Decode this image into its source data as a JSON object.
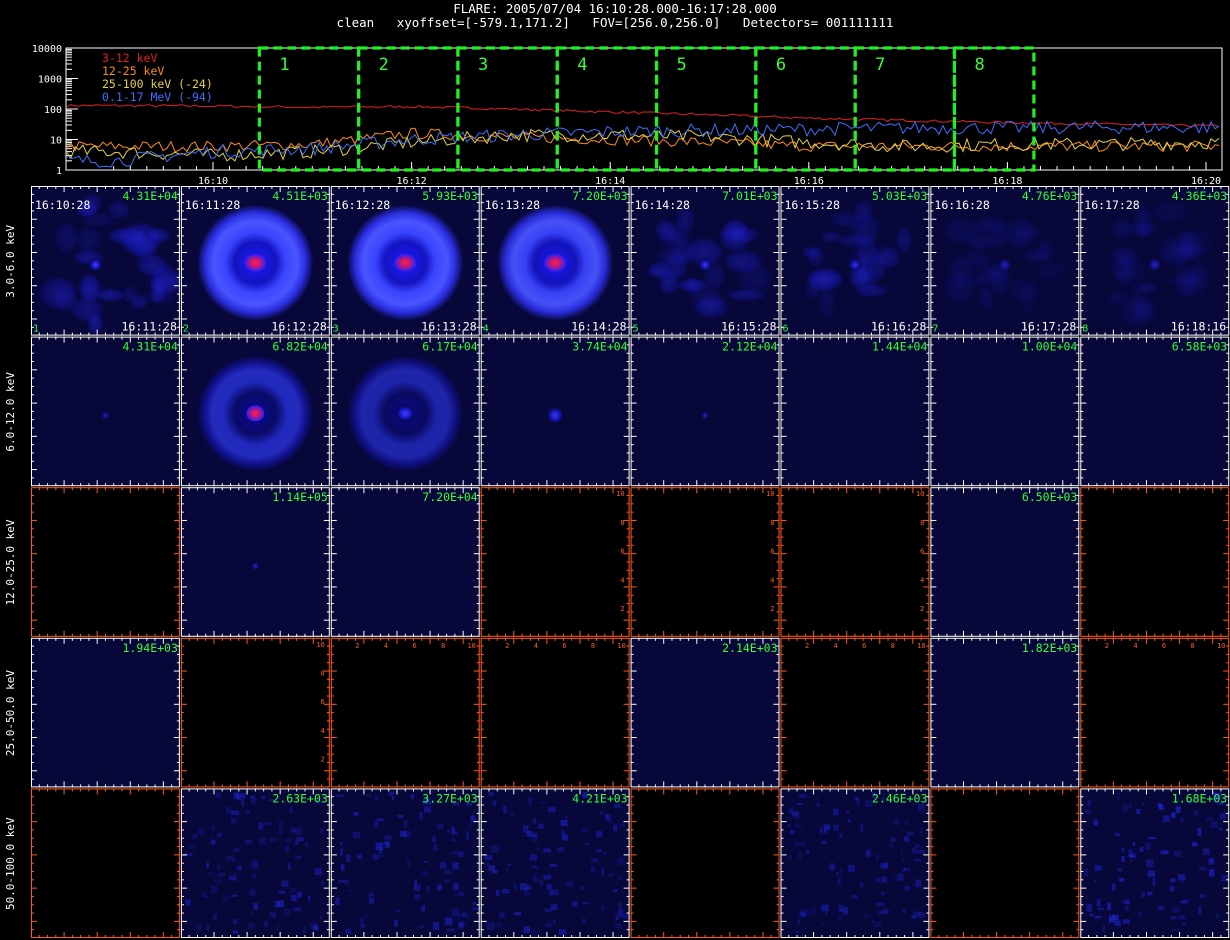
{
  "header": {
    "line1": "FLARE: 2005/07/04 16:10:28.000-16:17:28.000",
    "line2": "clean   xyoffset=[-579.1,171.2]   FOV=[256.0,256.0]   Detectors= 001111111"
  },
  "colors": {
    "low": "#e02020",
    "mid": "#ff8c1a",
    "high": "#e6d040",
    "gamma": "#3a70ff",
    "box": "#22ee22",
    "label": "#33ff33",
    "frame": "#ffffff",
    "frame_empty": "#ff5a1e",
    "image_bg": "#07073a"
  },
  "chart_data": [
    {
      "type": "line",
      "y_scale": "log",
      "ylim": [
        1,
        10000
      ],
      "y_ticks": [
        "10000",
        "1000",
        "100",
        "10",
        "1"
      ],
      "x_range_minutes": [
        16.05,
        16.35
      ],
      "x_ticks": [
        "16:10",
        "16:12",
        "16:14",
        "16:16",
        "16:18",
        "16:20"
      ],
      "series": [
        {
          "name": "3-12 keV",
          "color": "#e02020",
          "x": [
            "16:09",
            "16:10",
            "16:11",
            "16:12",
            "16:13",
            "16:14",
            "16:15",
            "16:16",
            "16:17",
            "16:18",
            "16:19",
            "16:20"
          ],
          "values": [
            130,
            125,
            115,
            120,
            100,
            80,
            65,
            50,
            42,
            36,
            32,
            28
          ]
        },
        {
          "name": "12-25 keV",
          "color": "#ff8c1a",
          "x": [
            "16:09",
            "16:10",
            "16:11",
            "16:12",
            "16:13",
            "16:14",
            "16:15",
            "16:16",
            "16:17",
            "16:18",
            "16:19",
            "16:20"
          ],
          "values": [
            6,
            6,
            7,
            16,
            12,
            10,
            8,
            6,
            6,
            6,
            6,
            6
          ]
        },
        {
          "name": "25-100 keV (-24)",
          "color": "#e6d040",
          "x": [
            "16:09",
            "16:10",
            "16:11",
            "16:12",
            "16:13",
            "16:14",
            "16:15",
            "16:16",
            "16:17",
            "16:18",
            "16:19",
            "16:20"
          ],
          "values": [
            4,
            3,
            4,
            8,
            14,
            14,
            12,
            8,
            6,
            7,
            7,
            8
          ]
        },
        {
          "name": "0.1-17 MeV (-94)",
          "color": "#3a70ff",
          "x": [
            "16:09",
            "16:10",
            "16:11",
            "16:12",
            "16:13",
            "16:14",
            "16:15",
            "16:16",
            "16:17",
            "16:18",
            "16:19",
            "16:20"
          ],
          "values": [
            2,
            4,
            5,
            10,
            14,
            18,
            20,
            22,
            24,
            24,
            25,
            25
          ]
        }
      ],
      "intervals": [
        {
          "label": "1",
          "start": "16:10:28",
          "end": "16:11:28"
        },
        {
          "label": "2",
          "start": "16:11:28",
          "end": "16:12:28"
        },
        {
          "label": "3",
          "start": "16:12:28",
          "end": "16:13:28"
        },
        {
          "label": "4",
          "start": "16:13:28",
          "end": "16:14:28"
        },
        {
          "label": "5",
          "start": "16:14:28",
          "end": "16:15:28"
        },
        {
          "label": "6",
          "start": "16:15:28",
          "end": "16:16:28"
        },
        {
          "label": "7",
          "start": "16:16:28",
          "end": "16:17:28"
        },
        {
          "label": "8",
          "start": "16:17:28",
          "end": "16:18:16"
        }
      ]
    },
    {
      "type": "heatmap",
      "row_labels": [
        "3.0-6.0 keV",
        "6.0-12.0 keV",
        "12.0-25.0 keV",
        "25.0-50.0 keV",
        "50.0-100.0 keV"
      ],
      "time_start": [
        "16:10:28",
        "16:11:28",
        "16:12:28",
        "16:13:28",
        "16:14:28",
        "16:15:28",
        "16:16:28",
        "16:17:28"
      ],
      "time_end": [
        "16:11:28",
        "16:12:28",
        "16:13:28",
        "16:14:28",
        "16:15:28",
        "16:16:28",
        "16:17:28",
        "16:18:16"
      ],
      "interval_numbers": [
        "1",
        "2",
        "3",
        "4",
        "5",
        "6",
        "7",
        "8"
      ],
      "empty_axis_ticks": [
        "2",
        "4",
        "6",
        "8",
        "10"
      ],
      "cells": [
        [
          {
            "max": "4.31E+04",
            "kind": "blobby",
            "level": 0.7
          },
          {
            "max": "4.51E+03",
            "kind": "ring",
            "level": 1.0
          },
          {
            "max": "5.93E+03",
            "kind": "ring",
            "level": 1.0
          },
          {
            "max": "7.20E+03",
            "kind": "ring",
            "level": 0.9
          },
          {
            "max": "7.01E+03",
            "kind": "mottled",
            "level": 0.55
          },
          {
            "max": "5.03E+03",
            "kind": "mottled",
            "level": 0.45
          },
          {
            "max": "4.76E+03",
            "kind": "mottled",
            "level": 0.25
          },
          {
            "max": "4.36E+03",
            "kind": "mottled",
            "level": 0.3
          }
        ],
        [
          {
            "max": "4.31E+04",
            "kind": "dot",
            "level": 0.15
          },
          {
            "max": "6.82E+04",
            "kind": "ring",
            "level": 0.65
          },
          {
            "max": "6.17E+04",
            "kind": "ring",
            "level": 0.4
          },
          {
            "max": "3.74E+04",
            "kind": "dot",
            "level": 0.8
          },
          {
            "max": "2.12E+04",
            "kind": "dot",
            "level": 0.1
          },
          {
            "max": "1.44E+04",
            "kind": "flat",
            "level": 0
          },
          {
            "max": "1.00E+04",
            "kind": "flat",
            "level": 0
          },
          {
            "max": "6.58E+03",
            "kind": "flat",
            "level": 0
          }
        ],
        [
          {
            "max": "",
            "kind": "empty",
            "axes": []
          },
          {
            "max": "1.14E+05",
            "kind": "dot",
            "level": 0.15
          },
          {
            "max": "7.20E+04",
            "kind": "flat",
            "level": 0
          },
          {
            "max": "",
            "kind": "empty",
            "axes": [
              "right"
            ]
          },
          {
            "max": "",
            "kind": "empty",
            "axes": [
              "right"
            ]
          },
          {
            "max": "",
            "kind": "empty",
            "axes": [
              "right"
            ]
          },
          {
            "max": "6.50E+03",
            "kind": "flat",
            "level": 0
          },
          {
            "max": "",
            "kind": "empty",
            "axes": []
          }
        ],
        [
          {
            "max": "1.94E+03",
            "kind": "flat",
            "level": 0
          },
          {
            "max": "",
            "kind": "empty",
            "axes": [
              "right"
            ]
          },
          {
            "max": "",
            "kind": "empty",
            "axes": [
              "top"
            ]
          },
          {
            "max": "",
            "kind": "empty",
            "axes": [
              "top"
            ]
          },
          {
            "max": "2.14E+03",
            "kind": "flat",
            "level": 0
          },
          {
            "max": "",
            "kind": "empty",
            "axes": [
              "top"
            ]
          },
          {
            "max": "1.82E+03",
            "kind": "flat",
            "level": 0
          },
          {
            "max": "",
            "kind": "empty",
            "axes": [
              "top"
            ]
          }
        ],
        [
          {
            "max": "",
            "kind": "empty",
            "axes": []
          },
          {
            "max": "2.63E+03",
            "kind": "noise",
            "level": 0.35
          },
          {
            "max": "3.27E+03",
            "kind": "noise",
            "level": 0.35
          },
          {
            "max": "4.21E+03",
            "kind": "noise",
            "level": 0.35
          },
          {
            "max": "",
            "kind": "empty",
            "axes": []
          },
          {
            "max": "2.46E+03",
            "kind": "noise",
            "level": 0.3
          },
          {
            "max": "",
            "kind": "empty",
            "axes": []
          },
          {
            "max": "1.68E+03",
            "kind": "noise",
            "level": 0.4
          }
        ]
      ]
    }
  ]
}
